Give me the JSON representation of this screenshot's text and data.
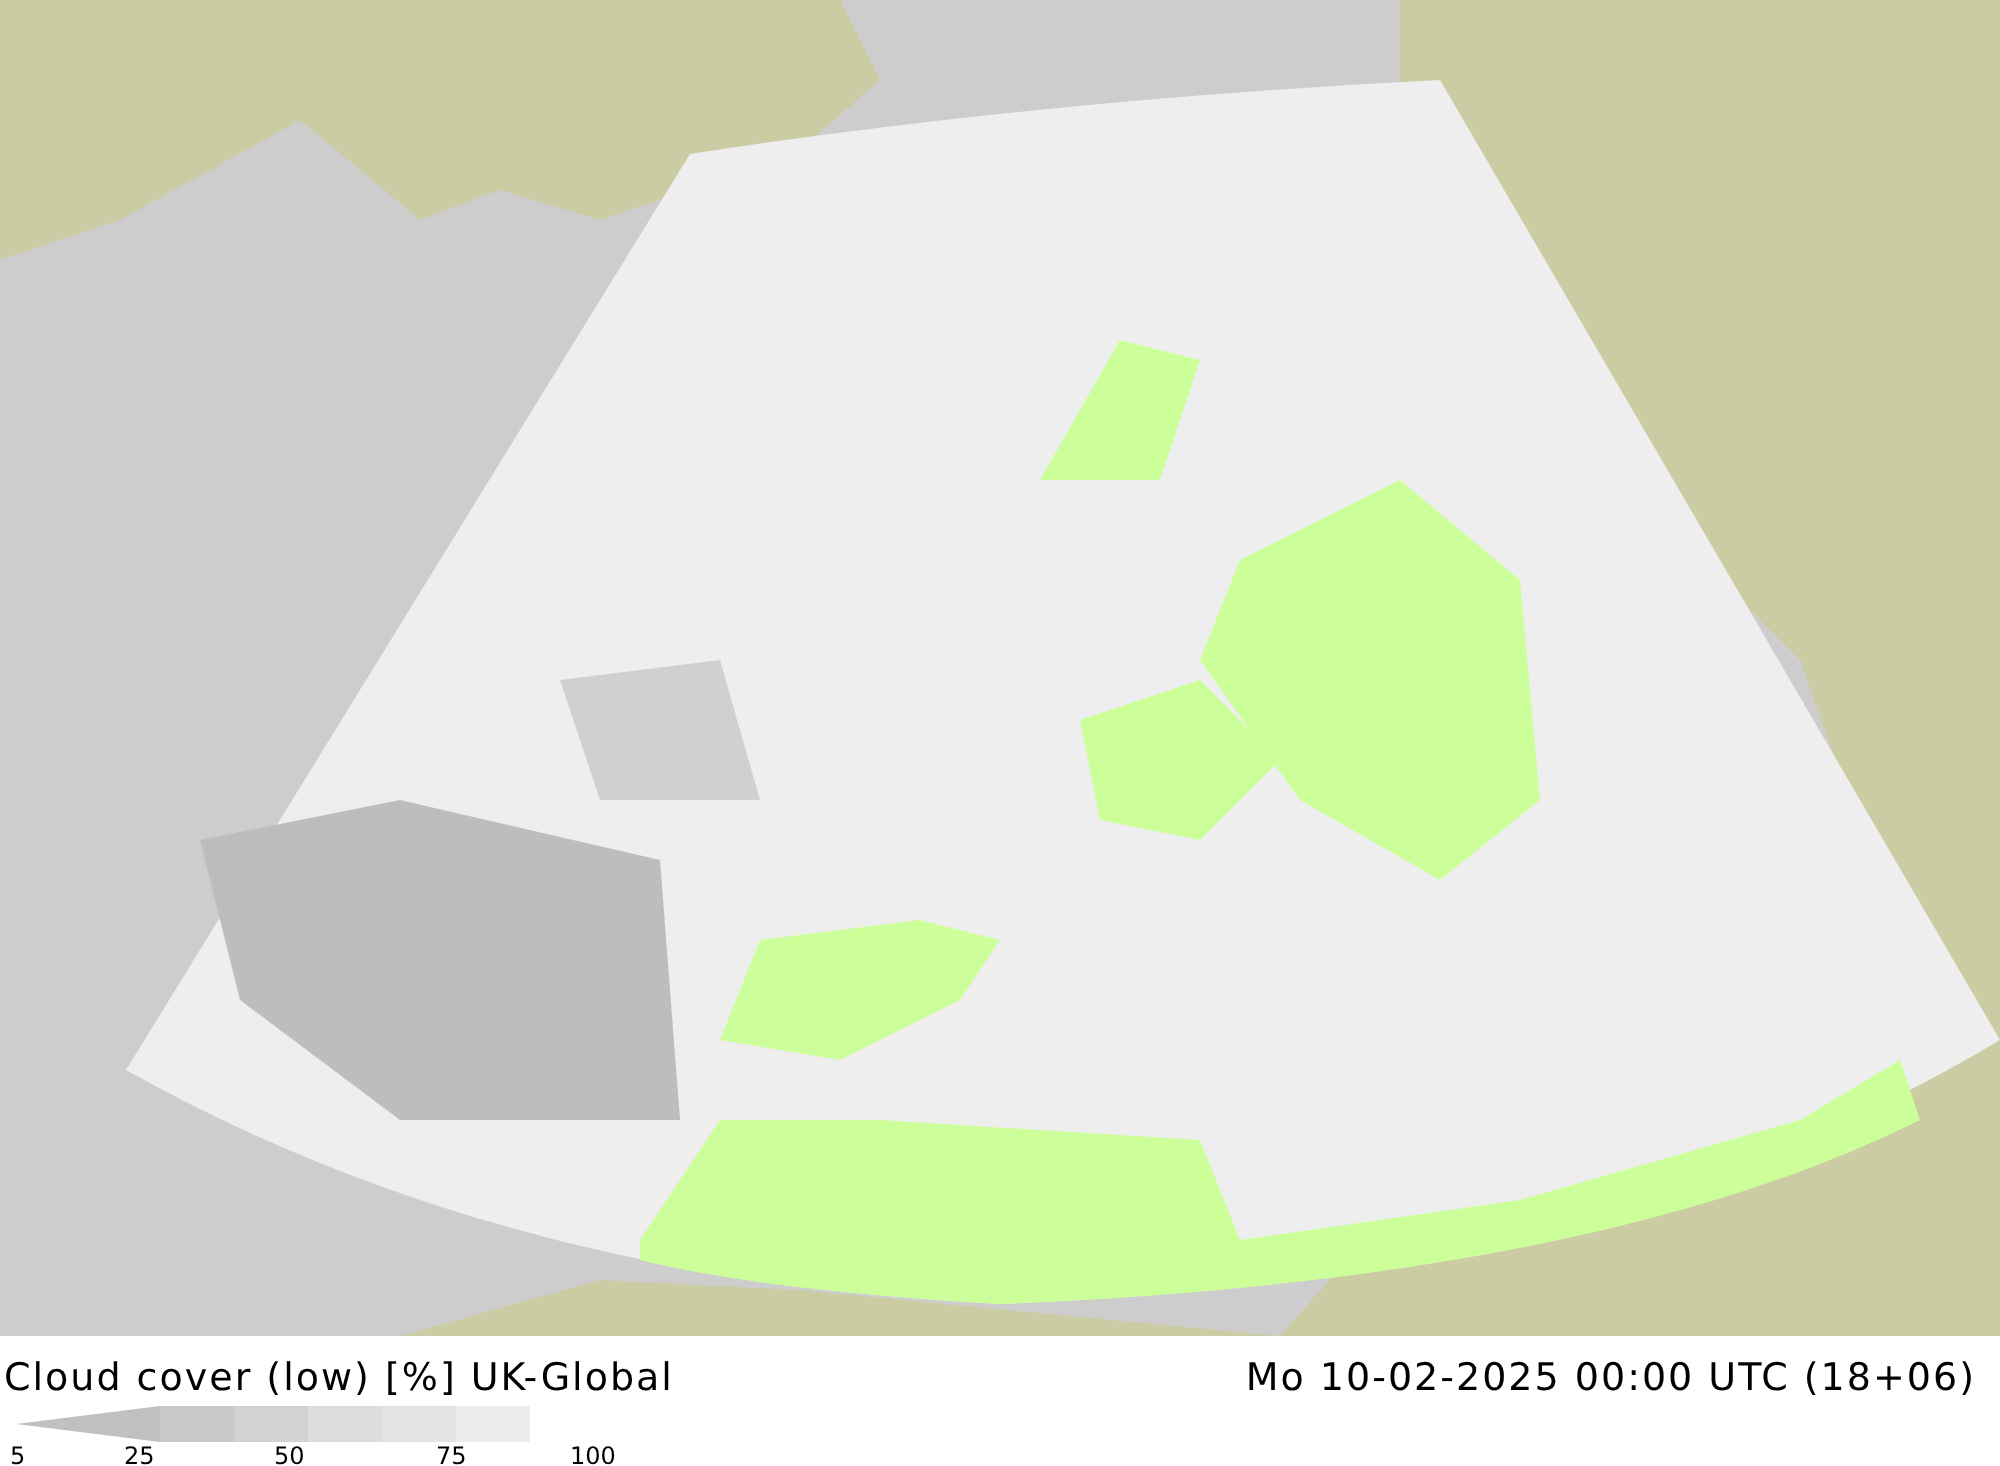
{
  "map": {
    "title": "Cloud cover (low) [%] UK-Global",
    "valid_time": "Mo 10-02-2025 00:00 UTC (18+06)"
  },
  "legend": {
    "segments": [
      {
        "color": "#c0c0c0"
      },
      {
        "color": "#c8c8c8"
      },
      {
        "color": "#d2d2d2"
      },
      {
        "color": "#dcdcdc"
      },
      {
        "color": "#e4e4e4"
      },
      {
        "color": "#ececec"
      }
    ],
    "ticks": [
      "5",
      "25",
      "50",
      "75",
      "100"
    ]
  }
}
